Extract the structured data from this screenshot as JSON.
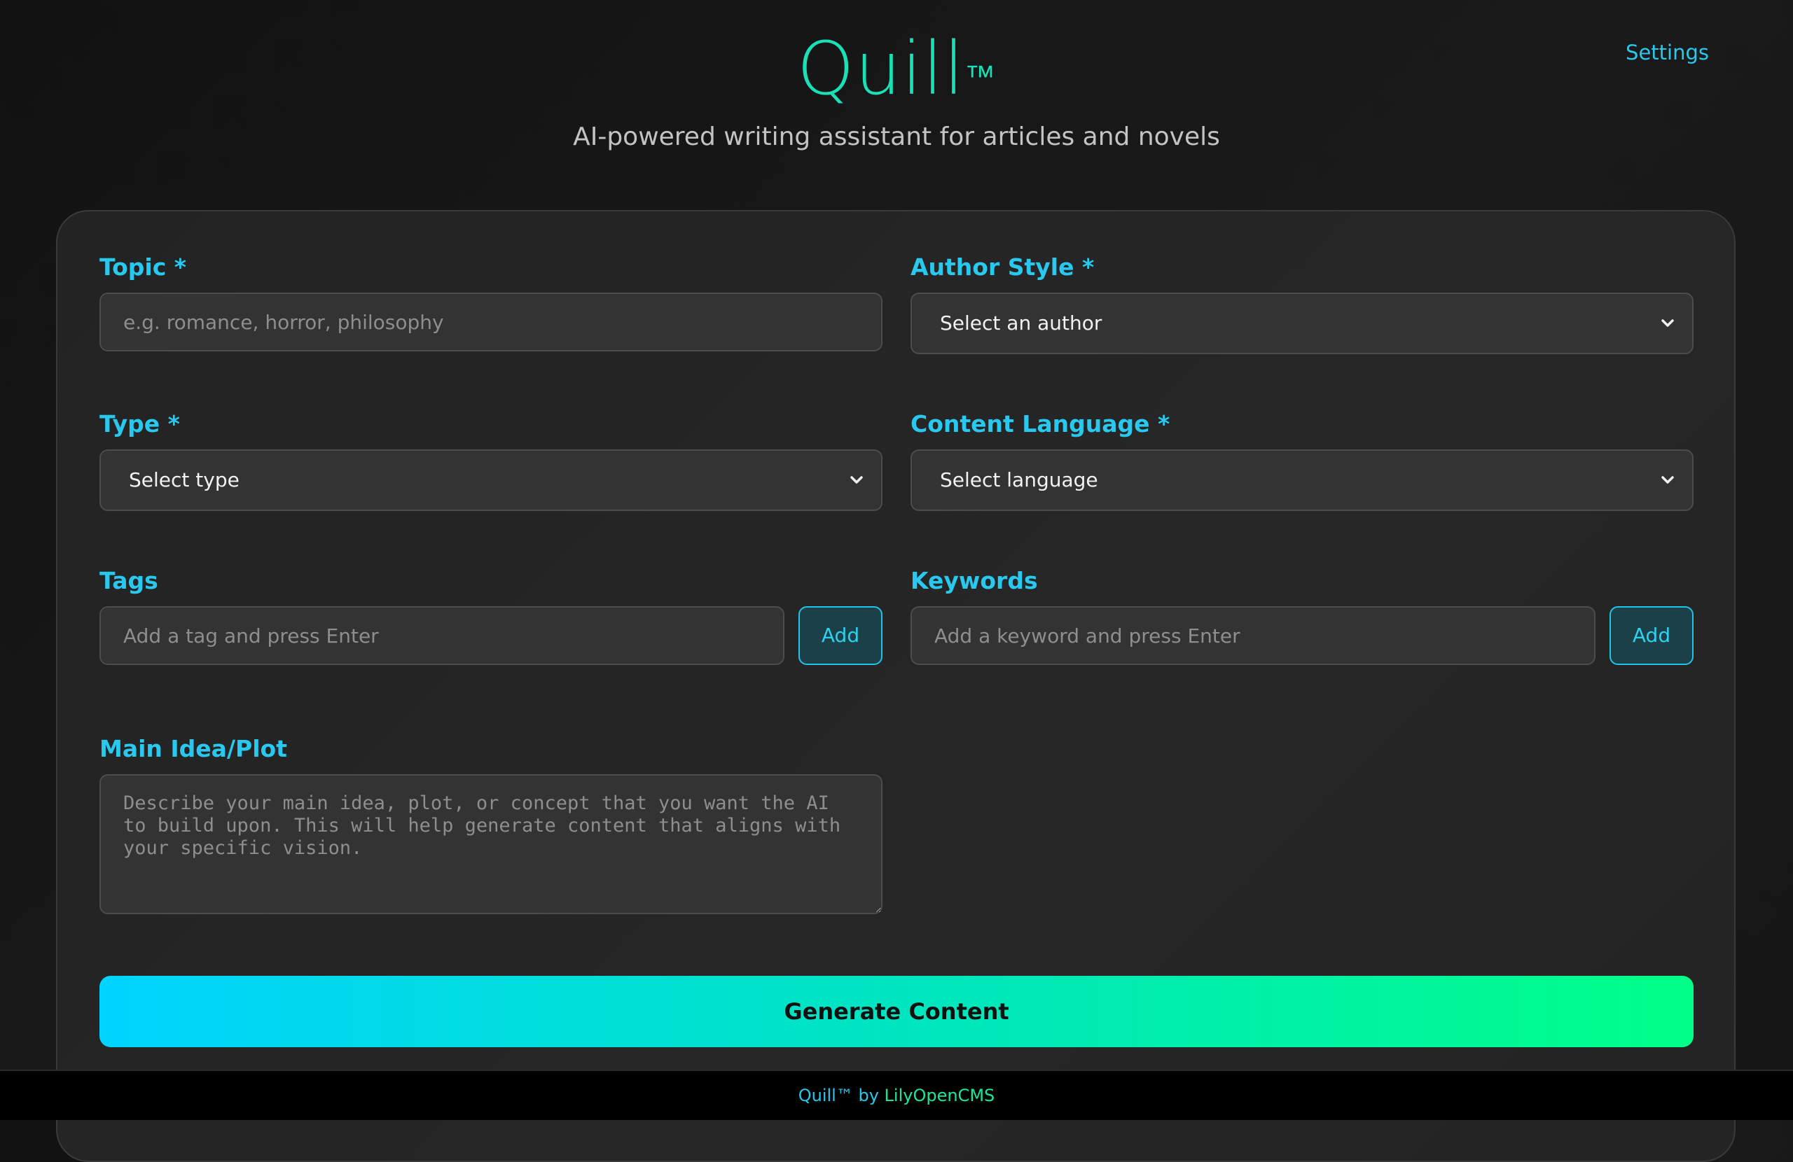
{
  "header": {
    "brand": "Quill",
    "brand_tm": "™",
    "subtitle": "AI-powered writing assistant for articles and novels",
    "settings_label": "Settings"
  },
  "form": {
    "topic": {
      "label": "Topic *",
      "placeholder": "e.g. romance, horror, philosophy"
    },
    "author_style": {
      "label": "Author Style *",
      "selected": "Select an author"
    },
    "type": {
      "label": "Type *",
      "selected": "Select type"
    },
    "content_language": {
      "label": "Content Language *",
      "selected": "Select language"
    },
    "tags": {
      "label": "Tags",
      "placeholder": "Add a tag and press Enter",
      "add_label": "Add"
    },
    "keywords": {
      "label": "Keywords",
      "placeholder": "Add a keyword and press Enter",
      "add_label": "Add"
    },
    "main_idea": {
      "label": "Main Idea/Plot",
      "placeholder": "Describe your main idea, plot, or concept that you want the AI to build upon. This will help generate content that aligns with your specific vision."
    },
    "generate_label": "Generate Content"
  },
  "footer": {
    "product": "Quill™",
    "by": " by ",
    "org": "LilyOpenCMS"
  },
  "colors": {
    "accent_cyan": "#29c8ee",
    "brand_teal": "#19e0b6",
    "gradient_start": "#00d4ff",
    "gradient_end": "#00ff88"
  },
  "icons": {
    "select_chevron": "chevron-down-icon",
    "textarea_resize": "resize-handle-icon"
  }
}
